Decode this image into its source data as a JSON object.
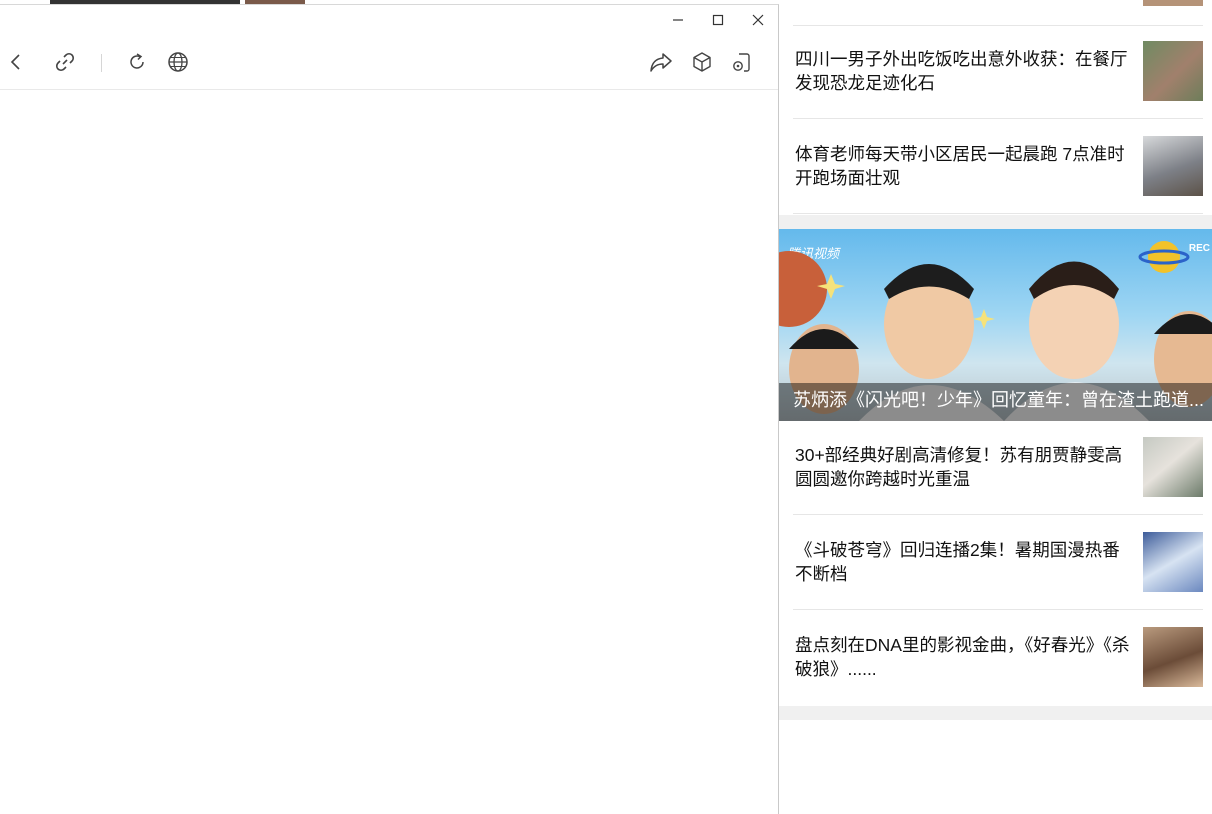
{
  "news": {
    "items_top": [
      {
        "title": "四川一男子外出吃饭吃出意外收获：在餐厅发现恐龙足迹化石",
        "thumb_color": "#7d8a6a"
      },
      {
        "title": "体育老师每天带小区居民一起晨跑 7点准时开跑场面壮观",
        "thumb_color": "#8f9294"
      }
    ],
    "video": {
      "caption": "苏炳添《闪光吧！少年》回忆童年：曾在渣土跑道...",
      "logo": "腾讯视频",
      "rec": "REC"
    },
    "items_bottom": [
      {
        "title": "30+部经典好剧高清修复！苏有朋贾静雯高圆圆邀你跨越时光重温",
        "thumb_color": "#b9bfb3"
      },
      {
        "title": "《斗破苍穹》回归连播2集！暑期国漫热番不断档",
        "thumb_color": "#8ea3c8"
      },
      {
        "title": "盘点刻在DNA里的影视金曲，《好春光》《杀破狼》......",
        "thumb_color": "#9a7b62"
      }
    ]
  },
  "colors": {
    "icon": "#444444",
    "separator": "#d6d6d6"
  }
}
